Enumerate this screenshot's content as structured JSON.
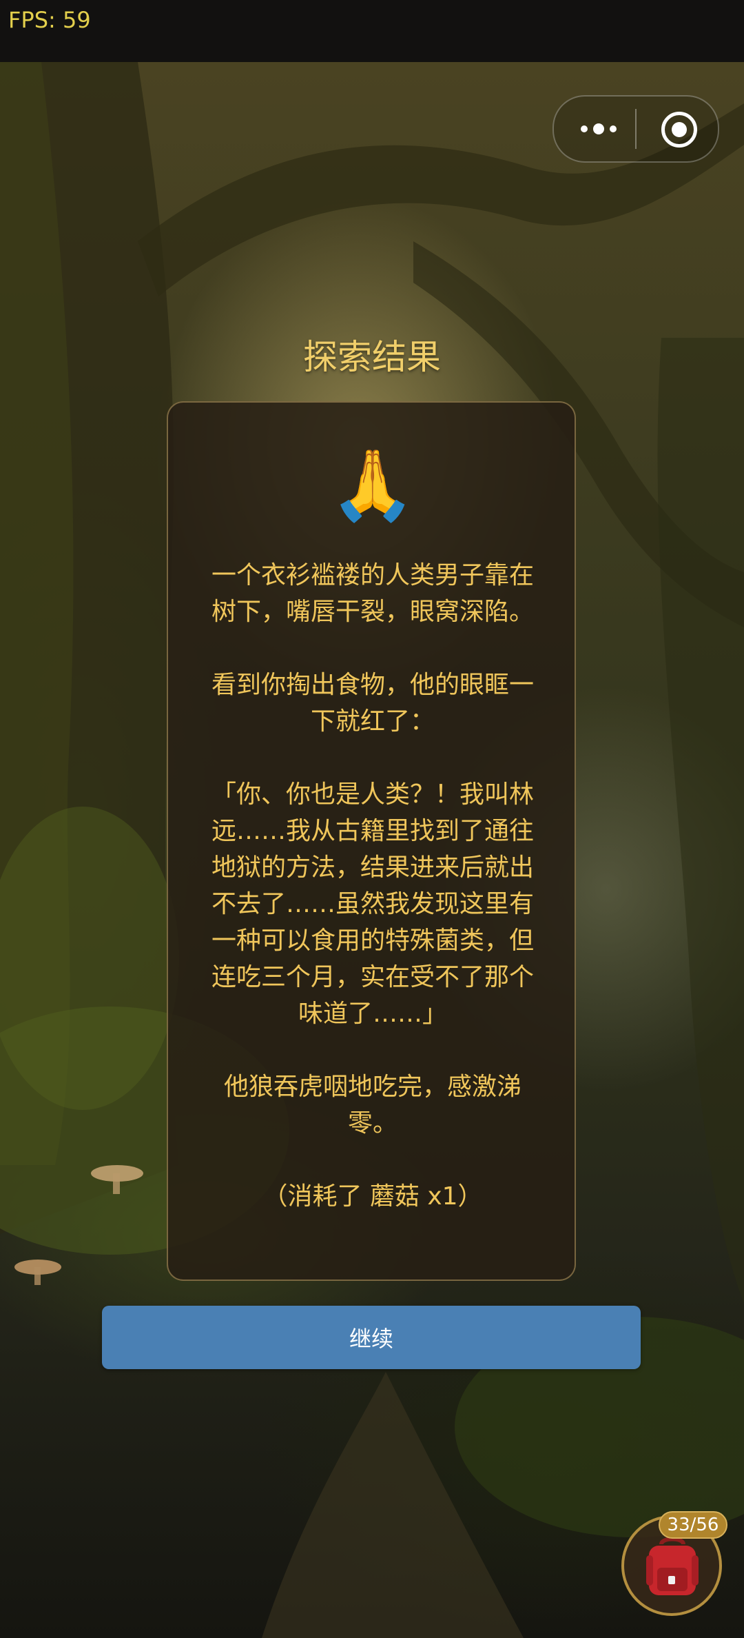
{
  "status": {
    "fps_text": "FPS: 59"
  },
  "capsule": {
    "more_icon": "more-dots-icon",
    "close_icon": "target-circle-icon"
  },
  "result": {
    "title": "探索结果",
    "emoji": "🙏",
    "paragraphs": [
      "一个衣衫褴褛的人类男子靠在树下，嘴唇干裂，眼窝深陷。",
      "看到你掏出食物，他的眼眶一下就红了：",
      "「你、你也是人类？！我叫林远……我从古籍里找到了通往地狱的方法，结果进来后就出不去了……虽然我发现这里有一种可以食用的特殊菌类，但连吃三个月，实在受不了那个味道了……」",
      "他狼吞虎咽地吃完，感激涕零。",
      "（消耗了 蘑菇 x1）"
    ]
  },
  "continue_button": {
    "label": "继续"
  },
  "backpack": {
    "count": "33/56",
    "icon": "backpack-icon"
  },
  "colors": {
    "title": "#f1cf6a",
    "text": "#f0c65b",
    "button": "#4a80b4",
    "badge": "#b0852c",
    "fps": "#e3cf4c"
  }
}
